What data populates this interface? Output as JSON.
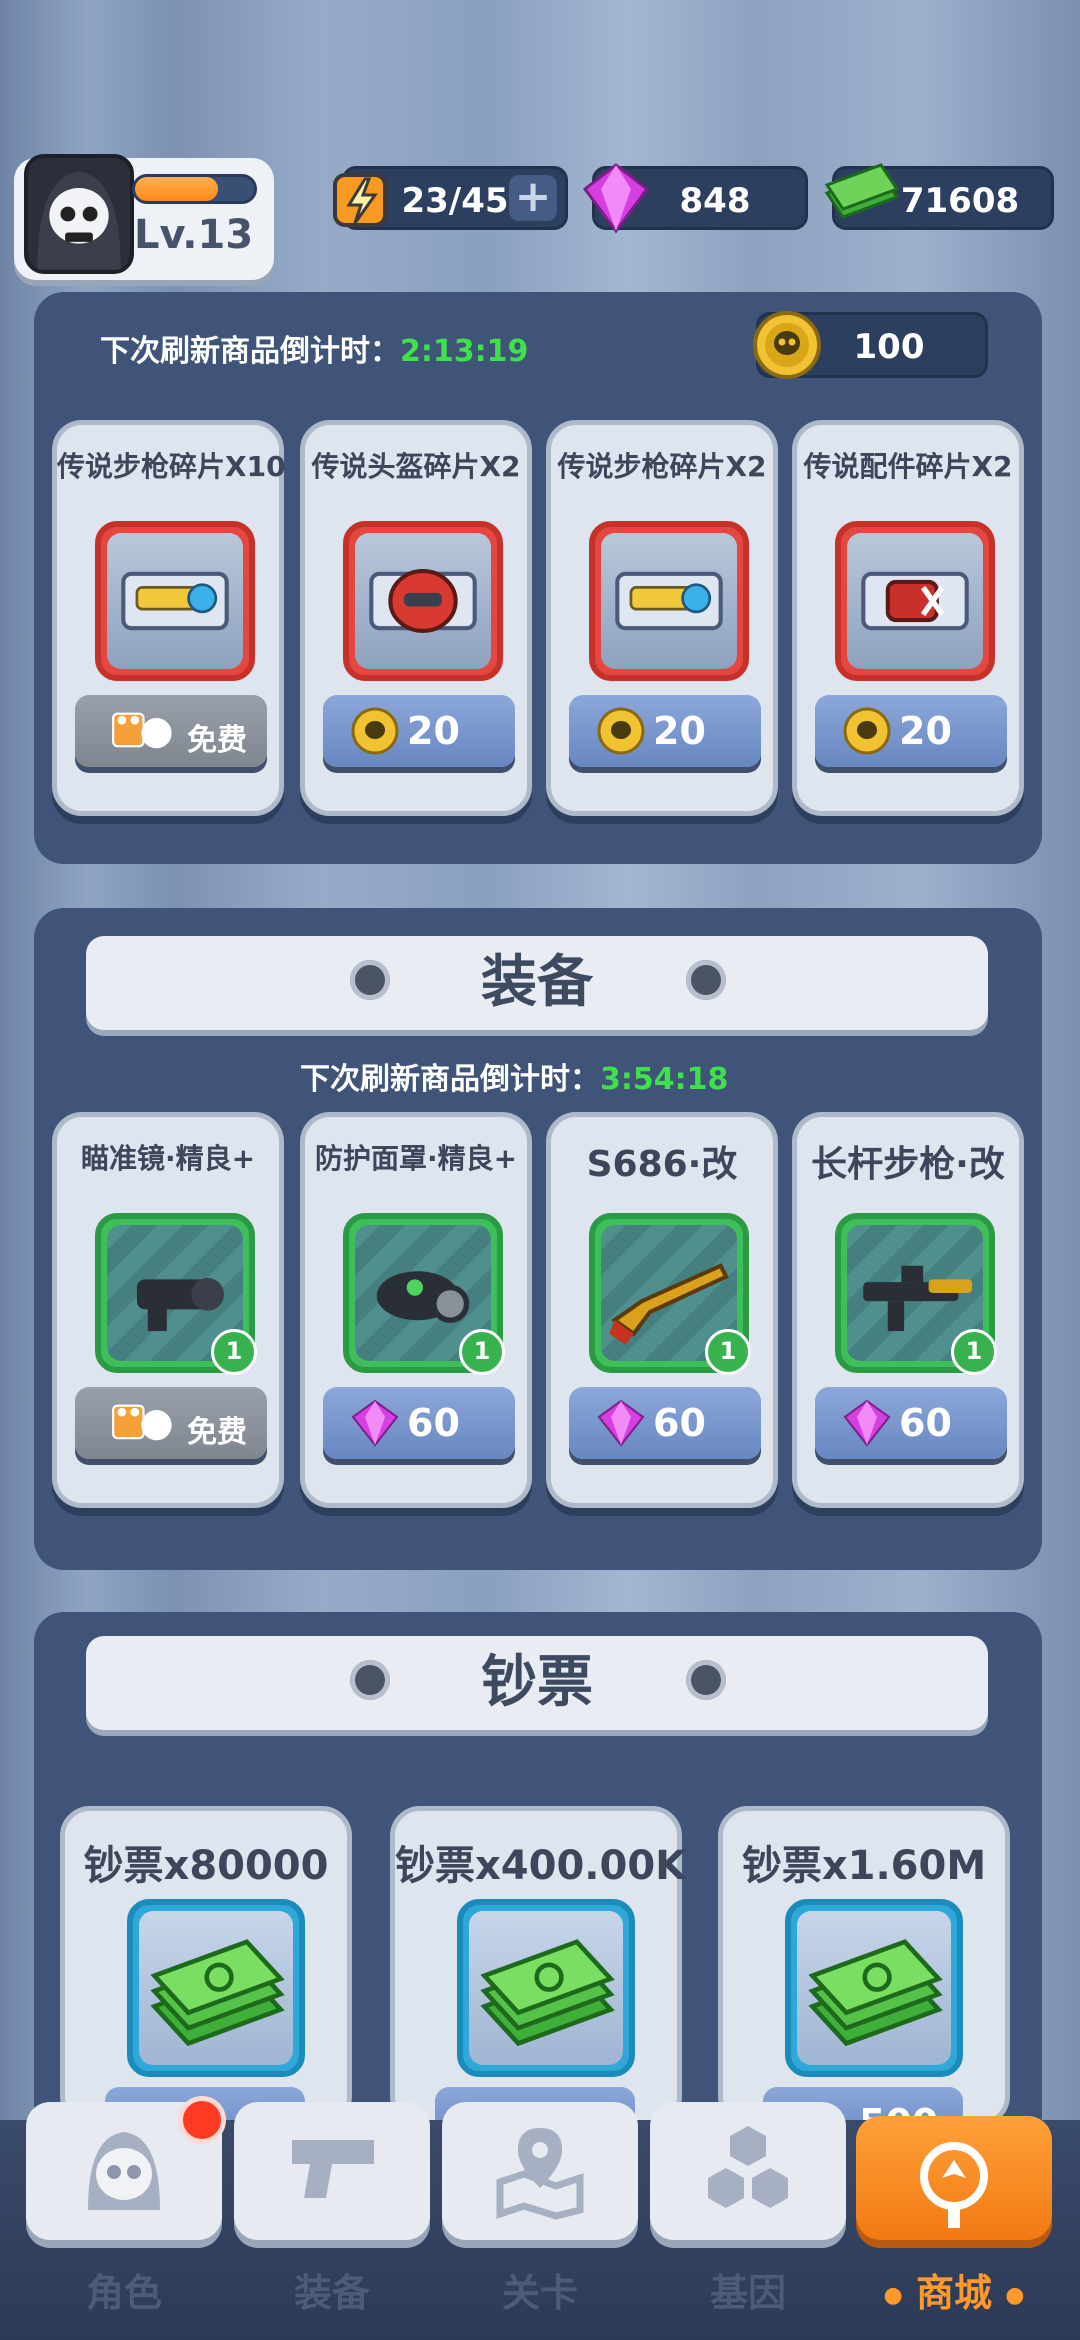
{
  "player": {
    "level": "Lv.13",
    "xp_progress": 0.7
  },
  "resources": {
    "energy": "23/45",
    "gems": "848",
    "cash": "71608"
  },
  "fragments_section": {
    "countdown_label": "下次刷新商品倒计时：",
    "countdown_time": "2:13:19",
    "coins": "100",
    "items": [
      {
        "name": "传说步枪碎片X10",
        "price": "免费",
        "currency": "ad"
      },
      {
        "name": "传说头盔碎片X2",
        "price": "20",
        "currency": "skull-coin"
      },
      {
        "name": "传说步枪碎片X2",
        "price": "20",
        "currency": "skull-coin"
      },
      {
        "name": "传说配件碎片X2",
        "price": "20",
        "currency": "skull-coin"
      }
    ]
  },
  "equipment_section": {
    "title": "装备",
    "countdown_label": "下次刷新商品倒计时：",
    "countdown_time": "3:54:18",
    "items": [
      {
        "name": "瞄准镜·精良+",
        "qty": "1",
        "price": "免费",
        "currency": "ad"
      },
      {
        "name": "防护面罩·精良+",
        "qty": "1",
        "price": "60",
        "currency": "gem"
      },
      {
        "name": "S686·改",
        "qty": "1",
        "price": "60",
        "currency": "gem"
      },
      {
        "name": "长杆步枪·改",
        "qty": "1",
        "price": "60",
        "currency": "gem"
      }
    ]
  },
  "cash_section": {
    "title": "钞票",
    "items": [
      {
        "name": "钞票x80000",
        "price": ""
      },
      {
        "name": "钞票x400.00K",
        "price": ""
      },
      {
        "name": "钞票x1.60M",
        "price": "500"
      }
    ]
  },
  "nav": {
    "items": [
      {
        "label": "角色",
        "icon": "skull-icon",
        "active": false,
        "badge": true
      },
      {
        "label": "装备",
        "icon": "gun-icon",
        "active": false
      },
      {
        "label": "关卡",
        "icon": "map-pin-icon",
        "active": false
      },
      {
        "label": "基因",
        "icon": "hexagon-icon",
        "active": false
      },
      {
        "label": "商城",
        "icon": "shop-icon",
        "active": true
      }
    ]
  },
  "colors": {
    "accent": "#f27a12",
    "timer": "#3fe14a",
    "panel": "#3f5478"
  }
}
